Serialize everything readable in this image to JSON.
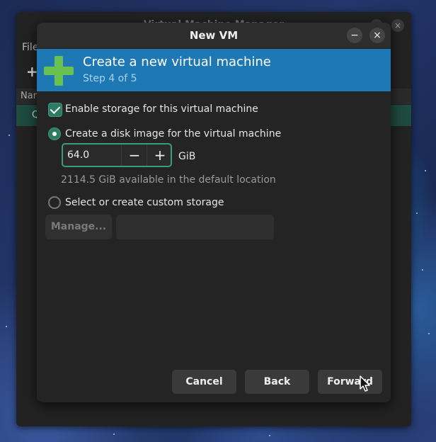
{
  "parent_window": {
    "title": "Virtual Machine Manager",
    "menu_file": "File",
    "toolbar_add": "+",
    "column_name": "Nar",
    "row_text": "Q",
    "minimize_glyph": "−",
    "close_glyph": "×"
  },
  "dialog": {
    "title": "New VM",
    "minimize_glyph": "−",
    "close_glyph": "×",
    "header": {
      "title": "Create a new virtual machine",
      "step": "Step 4 of 5",
      "icon": "plus-icon"
    },
    "enable_storage": {
      "label": "Enable storage for this virtual machine",
      "checked": true
    },
    "option_disk_image": {
      "label": "Create a disk image for the virtual machine",
      "selected": true
    },
    "disk_size": {
      "value": "64.0",
      "unit": "GiB",
      "decrement_glyph": "−",
      "increment_glyph": "+"
    },
    "available_text": "2114.5 GiB available in the default location",
    "option_custom": {
      "label": "Select or create custom storage",
      "selected": false
    },
    "manage_button": "Manage...",
    "buttons": {
      "cancel": "Cancel",
      "back": "Back",
      "forward": "Forward"
    }
  },
  "colors": {
    "accent_header": "#1e78b4",
    "check_green": "#2f7a62",
    "plus_green": "#6ac152",
    "dialog_bg": "#242424"
  }
}
